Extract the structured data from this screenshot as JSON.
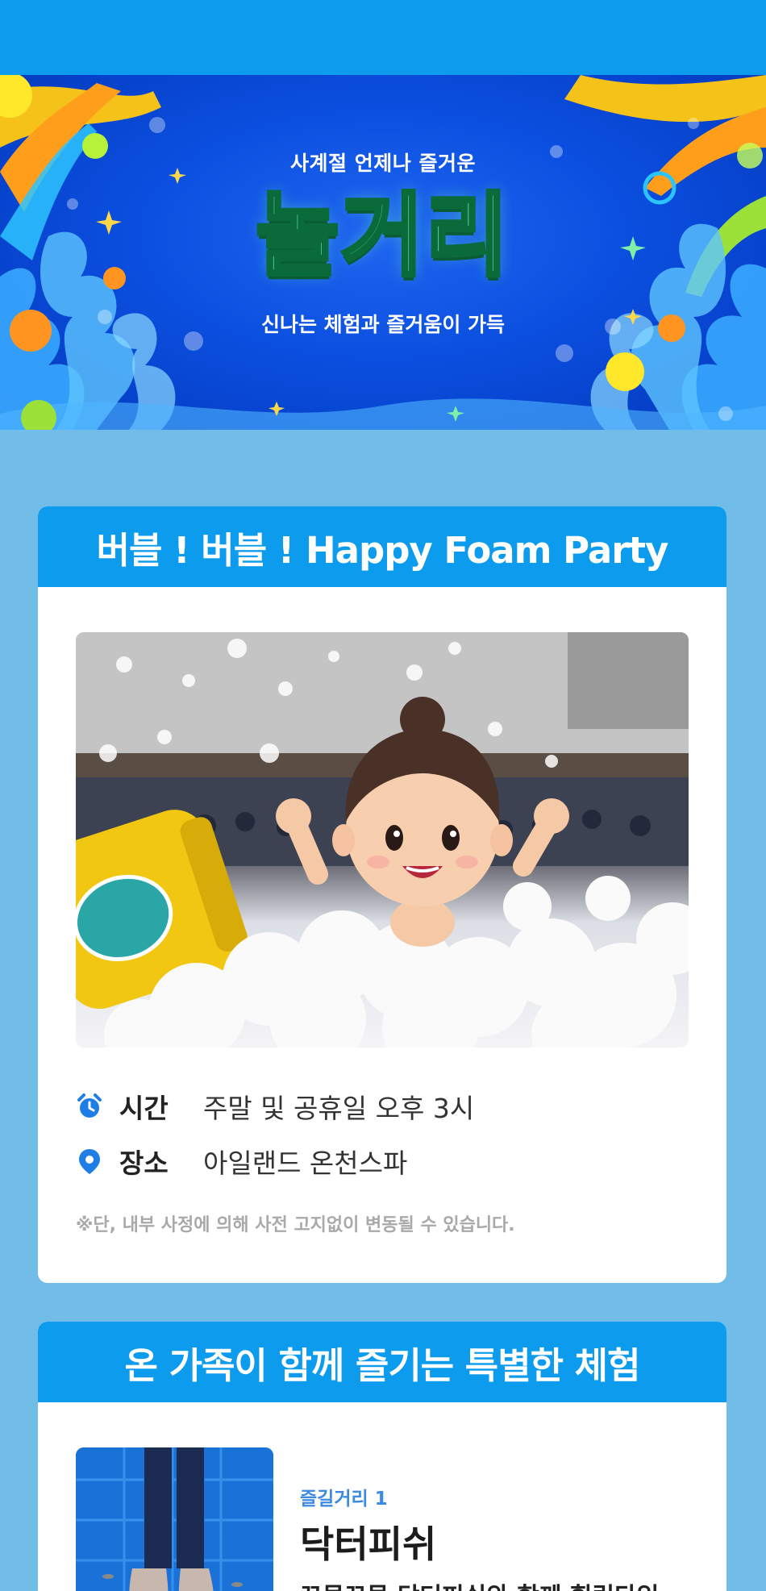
{
  "hero": {
    "subtitle": "사계절 언제나 즐거운",
    "title": "놀거리",
    "tagline": "신나는 체험과 즐거움이 가득"
  },
  "foam_party": {
    "heading": "버블 ! 버블 ! Happy Foam Party",
    "photo_label": "Foam Machine",
    "time_icon": "alarm-clock-icon",
    "time_label": "시간",
    "time_value": "주말 및 공휴일 오후 3시",
    "place_icon": "map-pin-icon",
    "place_label": "장소",
    "place_value": "아일랜드 온천스파",
    "notice": "※단, 내부 사정에 의해 사전 고지없이 변동될 수 있습니다."
  },
  "family": {
    "heading": "온 가족이 함께 즐기는 특별한 체험",
    "items": [
      {
        "tag": "즐길거리 1",
        "name": "닥터피쉬",
        "desc": "꼬물꼬물 닥터피쉬와 함께 힐링타임"
      }
    ]
  },
  "colors": {
    "brand_blue": "#0d9bee",
    "page_bg": "#71bde7",
    "accent_text": "#3c8be0"
  }
}
